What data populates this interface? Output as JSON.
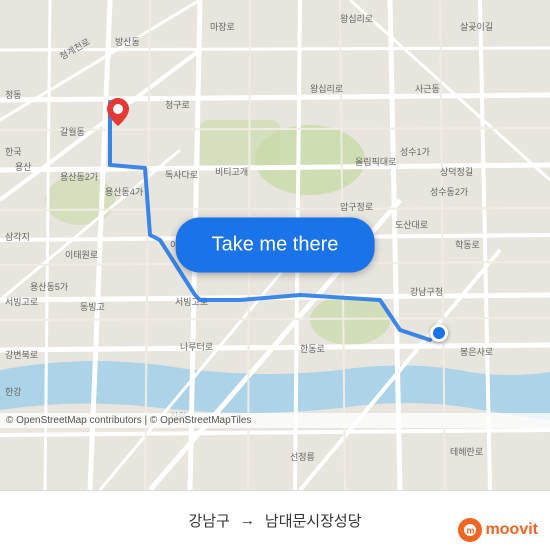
{
  "map": {
    "background_color": "#e8e0d8",
    "route_color": "#1a73e8",
    "origin_pin_color": "#e53935",
    "dest_dot_color": "#1a73e8"
  },
  "button": {
    "label": "Take me there",
    "bg_color": "#1a73e8",
    "text_color": "#ffffff"
  },
  "bottom_bar": {
    "from": "강남구",
    "arrow": "→",
    "to": "남대문시장성당"
  },
  "attribution": {
    "text": "© OpenStreetMap contributors | © OpenStreetMapTiles"
  },
  "logo": {
    "name": "moovit",
    "text": "moovit"
  }
}
